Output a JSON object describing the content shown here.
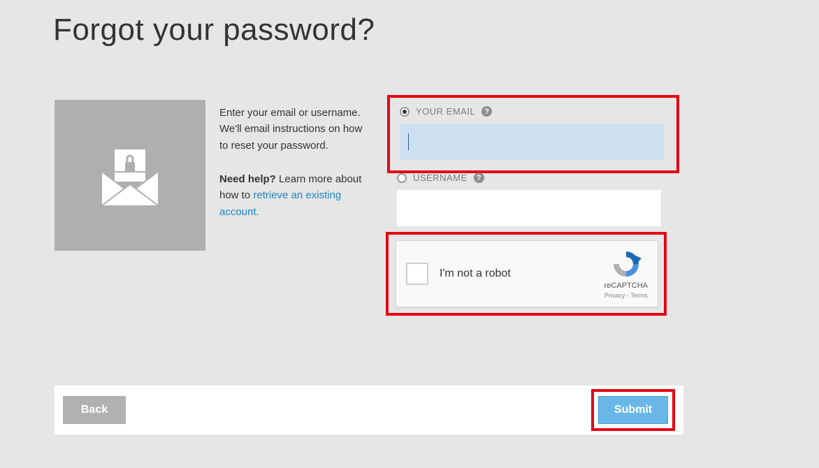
{
  "title": "Forgot your password?",
  "intro": "Enter your email or username. We'll email instructions on how to reset your password.",
  "help": {
    "prefix_bold": "Need help?",
    "text": " Learn more about how to ",
    "link_text": "retrieve an existing account."
  },
  "fields": {
    "email": {
      "label": "YOUR EMAIL",
      "value": "",
      "selected": true
    },
    "username": {
      "label": "USERNAME",
      "value": "",
      "selected": false
    }
  },
  "captcha": {
    "label": "I'm not a robot",
    "brand": "reCAPTCHA",
    "links": "Privacy - Terms"
  },
  "buttons": {
    "back": "Back",
    "submit": "Submit"
  },
  "icons": {
    "envelope_lock": "envelope-lock-icon",
    "help": "?"
  },
  "colors": {
    "highlight": "#e30613",
    "accent": "#69b7e8",
    "link": "#1f87c7"
  }
}
